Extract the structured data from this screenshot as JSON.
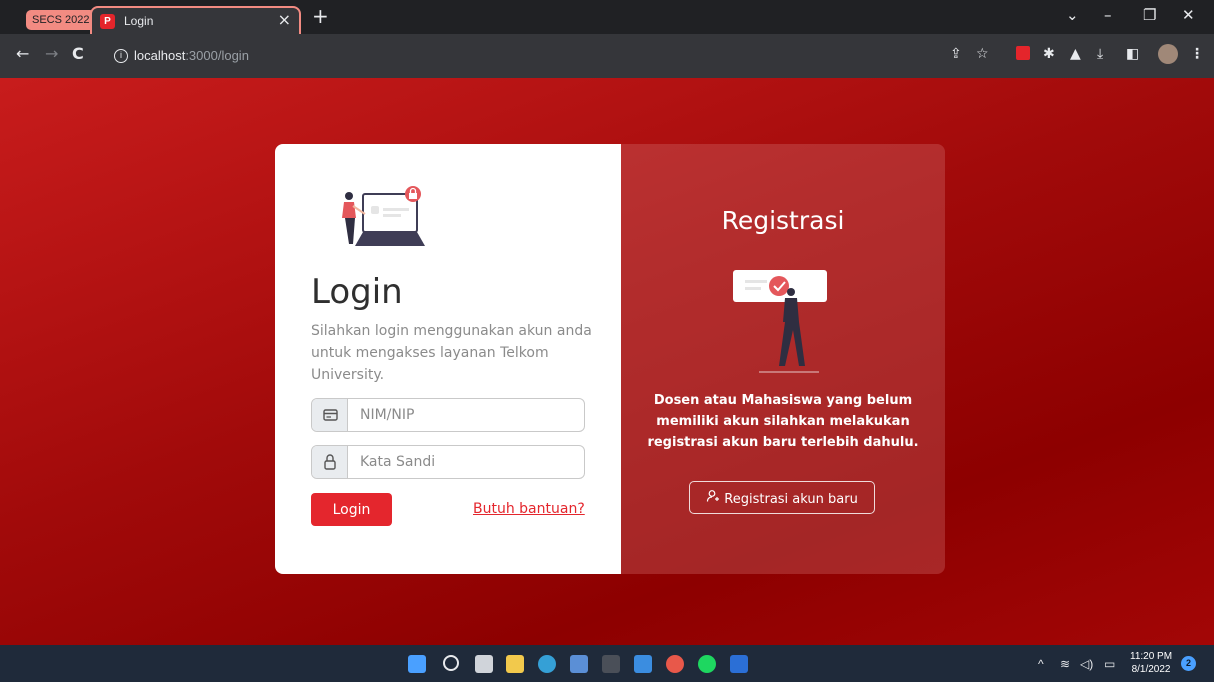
{
  "browser": {
    "tab_group": "SECS 2022",
    "tab_title": "Login",
    "favicon_glyph": "P",
    "url_host": "localhost",
    "url_path": ":3000/login"
  },
  "login": {
    "title": "Login",
    "description": "Silahkan login menggunakan akun anda untuk mengakses layanan Telkom University.",
    "nim_placeholder": "NIM/NIP",
    "password_placeholder": "Kata Sandi",
    "login_button": "Login",
    "help_link": "Butuh bantuan?"
  },
  "register": {
    "title": "Registrasi",
    "description": "Dosen atau Mahasiswa yang belum memiliki akun silahkan melakukan registrasi akun baru terlebih dahulu.",
    "button": "Registrasi akun baru"
  },
  "taskbar": {
    "time": "11:20 PM",
    "date": "8/1/2022",
    "notification_count": "2"
  },
  "colors": {
    "brand_red": "#e4262d",
    "page_bg": "#a10a0a",
    "tab_group": "#f28b82"
  }
}
